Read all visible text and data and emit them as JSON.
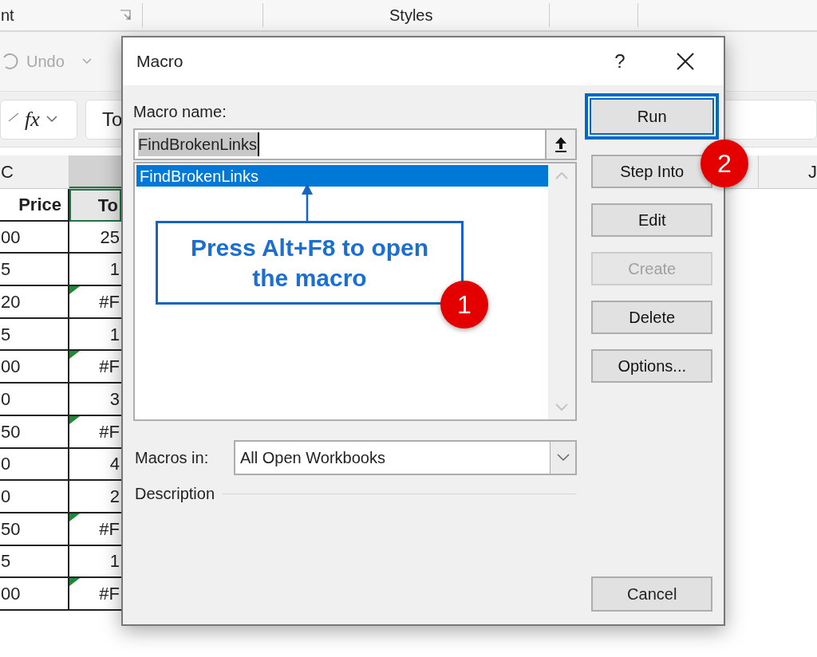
{
  "ribbon": {
    "groups": [
      {
        "label": "nt"
      },
      {
        "label": "Styles"
      }
    ]
  },
  "quick_access": {
    "undo": {
      "label": "Undo",
      "disabled": true
    }
  },
  "formula_bar": {
    "function_label": "fx",
    "contents": "To"
  },
  "sheet": {
    "column_c": "C",
    "column_j": "J",
    "rows": [
      {
        "kind": "header",
        "price": "Price",
        "total": "To",
        "error": false
      },
      {
        "kind": "data",
        "price": "00",
        "total": "25",
        "error": false
      },
      {
        "kind": "data",
        "price": "5",
        "total": "1",
        "error": false
      },
      {
        "kind": "data",
        "price": "20",
        "total": "#F",
        "error": true
      },
      {
        "kind": "data",
        "price": "5",
        "total": "1",
        "error": false
      },
      {
        "kind": "data",
        "price": "00",
        "total": "#F",
        "error": true
      },
      {
        "kind": "data",
        "price": "0",
        "total": "3",
        "error": false
      },
      {
        "kind": "data",
        "price": "50",
        "total": "#F",
        "error": true
      },
      {
        "kind": "data",
        "price": "0",
        "total": "4",
        "error": false
      },
      {
        "kind": "data",
        "price": "0",
        "total": "2",
        "error": false
      },
      {
        "kind": "data",
        "price": "50",
        "total": "#F",
        "error": true
      },
      {
        "kind": "data",
        "price": "5",
        "total": "1",
        "error": false
      },
      {
        "kind": "data",
        "price": "00",
        "total": "#F",
        "error": true
      }
    ]
  },
  "dialog": {
    "title": "Macro",
    "help": "?",
    "macro_name_label": "Macro name:",
    "macro_name_value": "FindBrokenLinks",
    "macros": [
      {
        "name": "FindBrokenLinks",
        "selected": true
      }
    ],
    "macros_in_label": "Macros in:",
    "macros_in_value": "All Open Workbooks",
    "description_label": "Description",
    "buttons": [
      {
        "label": "Run",
        "default": true,
        "disabled": false
      },
      {
        "label": "Step Into",
        "default": false,
        "disabled": false
      },
      {
        "label": "Edit",
        "default": false,
        "disabled": false
      },
      {
        "label": "Create",
        "default": false,
        "disabled": true
      },
      {
        "label": "Delete",
        "default": false,
        "disabled": false
      },
      {
        "label": "Options...",
        "default": false,
        "disabled": false
      }
    ],
    "cancel": "Cancel"
  },
  "callout": {
    "text": "Press Alt+F8 to open the macro",
    "step": "1"
  },
  "run_step": "2"
}
